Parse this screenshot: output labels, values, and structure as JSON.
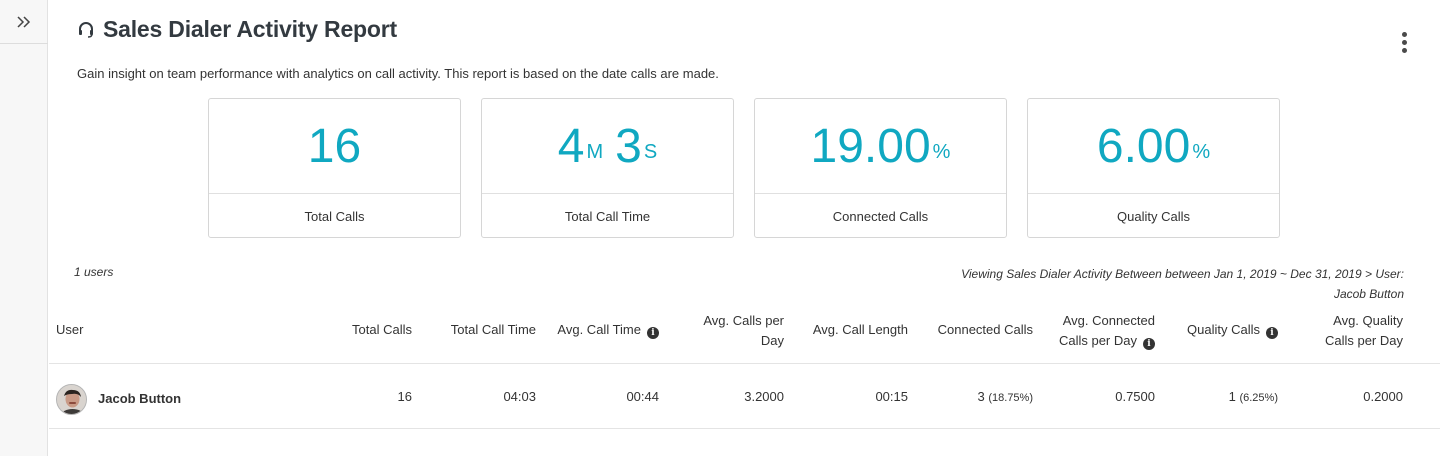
{
  "sidebar": {
    "toggle_icon": "double-chevron-right-icon"
  },
  "header": {
    "title_icon": "headset-icon",
    "title": "Sales Dialer Activity Report",
    "menu_icon": "kebab-menu-icon",
    "subtitle": "Gain insight on team performance with analytics on call activity. This report is based on the date calls are made."
  },
  "accent_color": "#10a8c1",
  "cards": [
    {
      "value": "16",
      "label": "Total Calls"
    },
    {
      "minutes": "4",
      "minutes_unit": "M",
      "seconds": "3",
      "seconds_unit": "S",
      "label": "Total Call Time"
    },
    {
      "value": "19.00",
      "unit": "%",
      "label": "Connected Calls"
    },
    {
      "value": "6.00",
      "unit": "%",
      "label": "Quality Calls"
    }
  ],
  "summary": {
    "users_count": "1 users",
    "viewing_line1": "Viewing Sales Dialer Activity Between between Jan 1, 2019 ~ Dec 31, 2019 > User:",
    "viewing_line2": "Jacob Button"
  },
  "table": {
    "columns": {
      "user": "User",
      "total_calls": "Total Calls",
      "total_call_time": "Total Call Time",
      "avg_call_time": "Avg. Call Time",
      "avg_calls_per_day_1": "Avg. Calls per",
      "avg_calls_per_day_2": "Day",
      "avg_call_length": "Avg. Call Length",
      "connected_calls": "Connected Calls",
      "avg_connected_1": "Avg. Connected",
      "avg_connected_2": "Calls per Day",
      "quality_calls": "Quality Calls",
      "avg_quality_1": "Avg. Quality",
      "avg_quality_2": "Calls per Day"
    },
    "info_icon_glyph": "i",
    "rows": [
      {
        "user": "Jacob Button",
        "total_calls": "16",
        "total_call_time": "04:03",
        "avg_call_time": "00:44",
        "avg_calls_per_day": "3.2000",
        "avg_call_length": "00:15",
        "connected_calls": "3",
        "connected_pct": "(18.75%)",
        "avg_connected_per_day": "0.7500",
        "quality_calls": "1",
        "quality_pct": "(6.25%)",
        "avg_quality_per_day": "0.2000"
      }
    ]
  }
}
